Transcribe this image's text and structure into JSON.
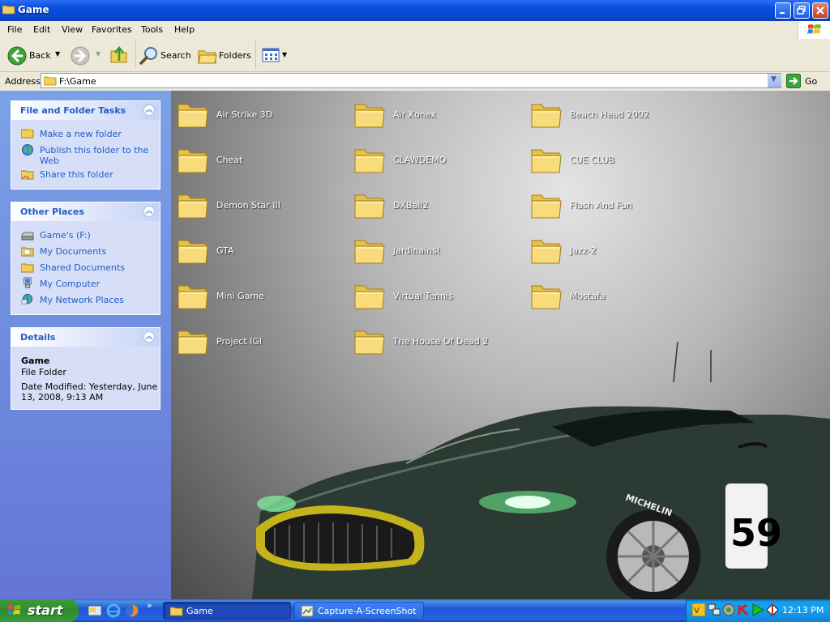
{
  "window": {
    "title": "Game"
  },
  "menu": [
    "File",
    "Edit",
    "View",
    "Favorites",
    "Tools",
    "Help"
  ],
  "toolbar": {
    "back": "Back",
    "search": "Search",
    "folders": "Folders"
  },
  "address": {
    "label": "Address",
    "value": "F:\\Game",
    "go": "Go"
  },
  "tasks": {
    "title": "File and Folder Tasks",
    "items": [
      {
        "label": "Make a new folder",
        "icon": "new-folder-icon"
      },
      {
        "label": "Publish this folder to the",
        "label2": "Web",
        "icon": "publish-web-icon"
      },
      {
        "label": "Share this folder",
        "icon": "share-folder-icon"
      }
    ]
  },
  "other_places": {
    "title": "Other Places",
    "items": [
      {
        "label": "Game's (F:)",
        "icon": "drive-icon"
      },
      {
        "label": "My Documents",
        "icon": "my-documents-icon"
      },
      {
        "label": "Shared Documents",
        "icon": "shared-documents-icon"
      },
      {
        "label": "My Computer",
        "icon": "my-computer-icon"
      },
      {
        "label": "My Network Places",
        "icon": "network-places-icon"
      }
    ]
  },
  "details": {
    "title": "Details",
    "name": "Game",
    "type": "File Folder",
    "modified_line1": "Date Modified: Yesterday, June",
    "modified_line2": "13, 2008, 9:13 AM"
  },
  "folders": [
    "Air Strike 3D",
    "Air Xonex",
    "Beach Head 2002",
    "Cheat",
    "CLAWDEMO",
    "CUE CLUB",
    "Demon Star III",
    "DXBall2",
    "Flash And Fun",
    "GTA",
    "Jardinains!",
    "Jazz-2",
    "Mini Game",
    "Virtual Tennis",
    "Mostafa",
    "Project IGI",
    "The House Of Dead 2"
  ],
  "taskbar": {
    "start": "start",
    "tasks": [
      "Game",
      "Capture-A-ScreenShot"
    ],
    "clock": "12:13 PM"
  },
  "wallpaper": {
    "car_number": "59",
    "tire_brand": "MICHELIN"
  }
}
